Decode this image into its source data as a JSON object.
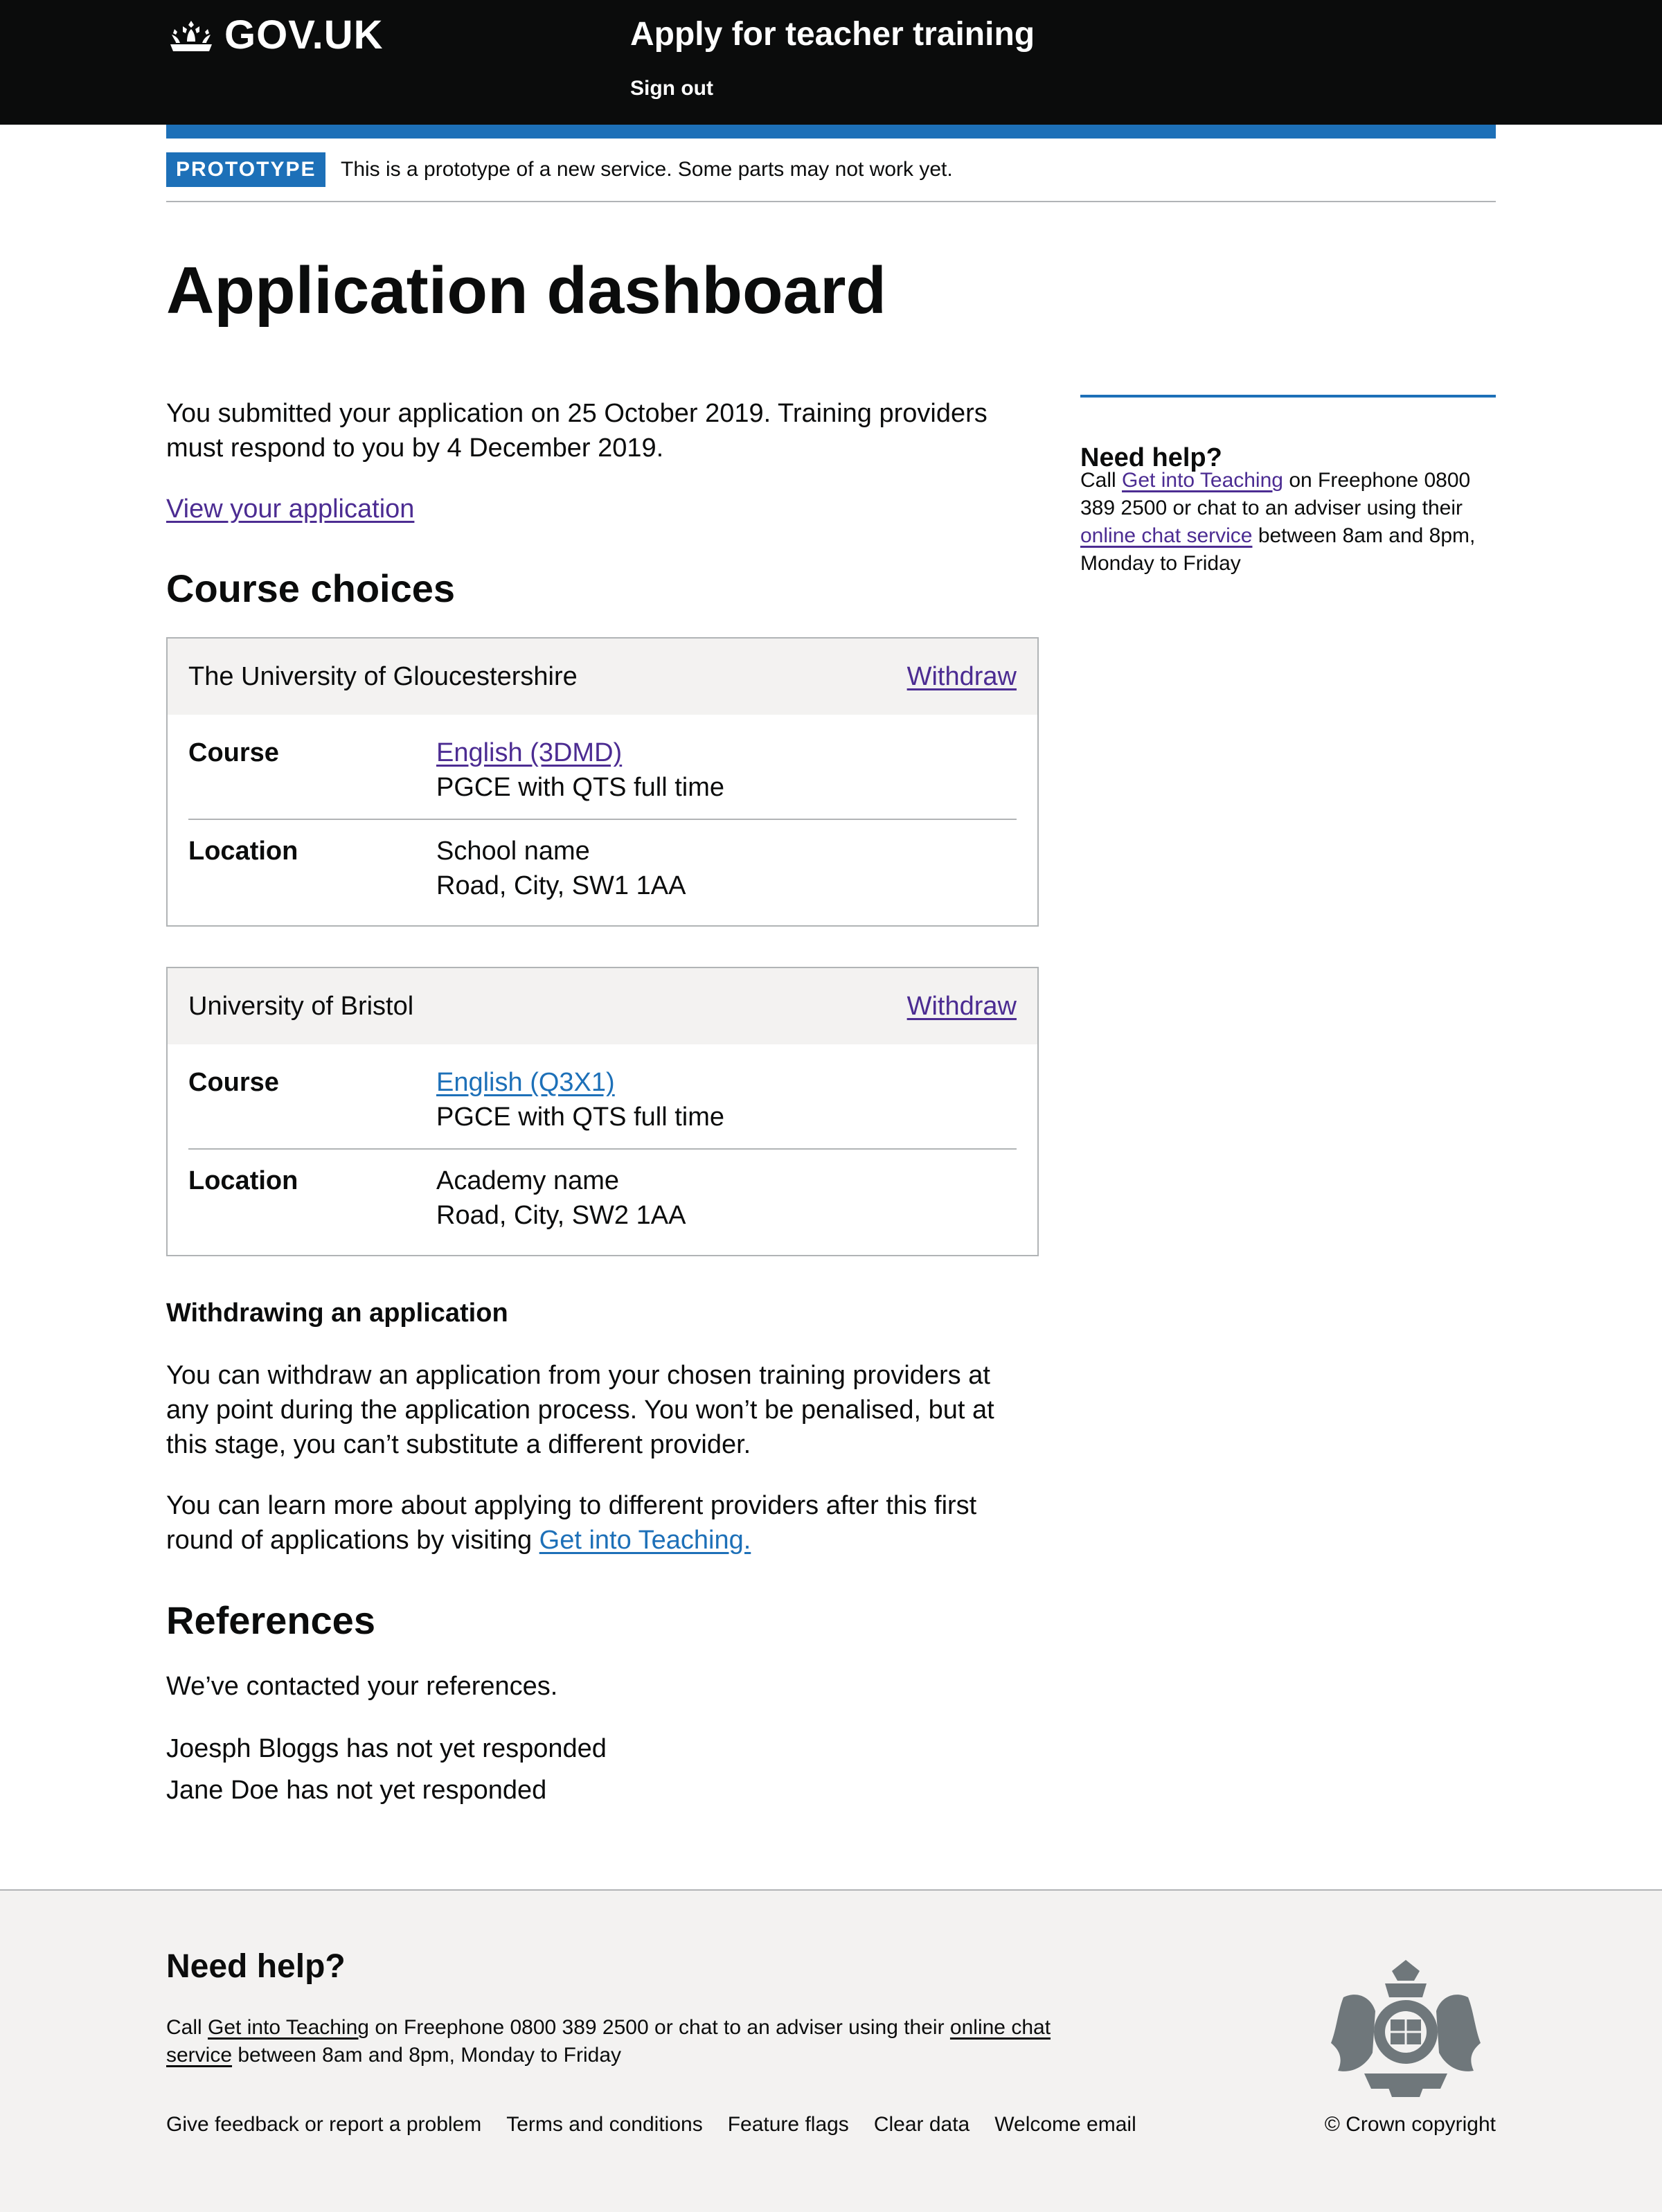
{
  "header": {
    "logo_text": "GOV.UK",
    "service_name": "Apply for teacher training",
    "sign_out": "Sign out"
  },
  "phase_banner": {
    "tag": "PROTOTYPE",
    "text": "This is a prototype of a new service. Some parts may not work yet."
  },
  "main": {
    "title": "Application dashboard",
    "intro": "You submitted your application on 25 October 2019. Training providers must respond to you by 4 December 2019.",
    "view_link": "View your application",
    "course_choices_heading": "Course choices",
    "choices": [
      {
        "provider": "The University of Gloucestershire",
        "action": "Withdraw",
        "course_key": "Course",
        "course_link": "English (3DMD)",
        "course_detail": "PGCE with QTS full time",
        "location_key": "Location",
        "location_line1": "School name",
        "location_line2": "Road, City, SW1 1AA"
      },
      {
        "provider": "University of Bristol",
        "action": "Withdraw",
        "course_key": "Course",
        "course_link": "English (Q3X1)",
        "course_detail": "PGCE with QTS full time",
        "location_key": "Location",
        "location_line1": "Academy name",
        "location_line2": "Road, City, SW2 1AA"
      }
    ],
    "withdraw_heading": "Withdrawing an application",
    "withdraw_p1": "You can withdraw an application from your chosen training providers at any point during the application process. You won’t be penalised, but at this stage, you can’t substitute a different provider.",
    "withdraw_p2_prefix": "You can learn more about applying to different providers after this first round of applications by visiting",
    "withdraw_p2_link": "Get into Teaching.",
    "references_heading": "References",
    "references_intro": "We’ve contacted your references.",
    "references": [
      "Joesph Bloggs has not yet responded",
      "Jane Doe has not yet responded"
    ]
  },
  "sidebar": {
    "heading": "Need help?",
    "call": "Call",
    "git_link": "Get into Teaching",
    "middle": "on Freephone 0800 389 2500 or chat to an adviser using their",
    "chat_link": "online chat service",
    "end": "between 8am and 8pm, Monday to Friday"
  },
  "footer": {
    "heading": "Need help?",
    "call": "Call",
    "git_link": "Get into Teaching",
    "middle": "on Freephone 0800 389 2500 or chat to an adviser using their",
    "chat_link": "online chat service",
    "end": "between 8am and 8pm, Monday to Friday",
    "links": [
      "Give feedback or report a problem",
      "Terms and conditions",
      "Feature flags",
      "Clear data",
      "Welcome email"
    ],
    "copyright": "© Crown copyright"
  },
  "colors": {
    "header_bg": "#0b0c0c",
    "brand_blue": "#1d70b8",
    "visited_link": "#4c2c92",
    "footer_bg": "#f3f2f1"
  }
}
